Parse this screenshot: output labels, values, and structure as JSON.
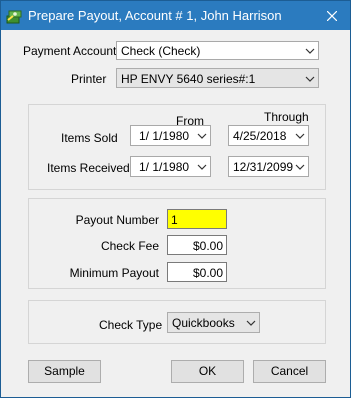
{
  "window": {
    "title": "Prepare Payout, Account # 1, John Harrison"
  },
  "payment_account": {
    "label": "Payment Account:",
    "value": "Check (Check)"
  },
  "printer": {
    "label": "Printer",
    "value": "HP ENVY 5640 series#:1"
  },
  "dates": {
    "from_header": "From",
    "through_header": "Through",
    "items_sold": {
      "label": "Items Sold",
      "from": "1/  1/1980",
      "through": "4/25/2018"
    },
    "items_received": {
      "label": "Items Received",
      "from": "1/  1/1980",
      "through": "12/31/2099"
    }
  },
  "payout": {
    "number_label": "Payout Number",
    "number_value": "1",
    "check_fee_label": "Check Fee",
    "check_fee_value": "$0.00",
    "min_payout_label": "Minimum Payout",
    "min_payout_value": "$0.00"
  },
  "check_type": {
    "label": "Check Type",
    "value": "Quickbooks"
  },
  "buttons": {
    "sample": "Sample",
    "ok": "OK",
    "cancel": "Cancel"
  },
  "icons": {
    "app": "app-icon",
    "close": "close-icon",
    "dropdown": "chevron-down-icon"
  }
}
